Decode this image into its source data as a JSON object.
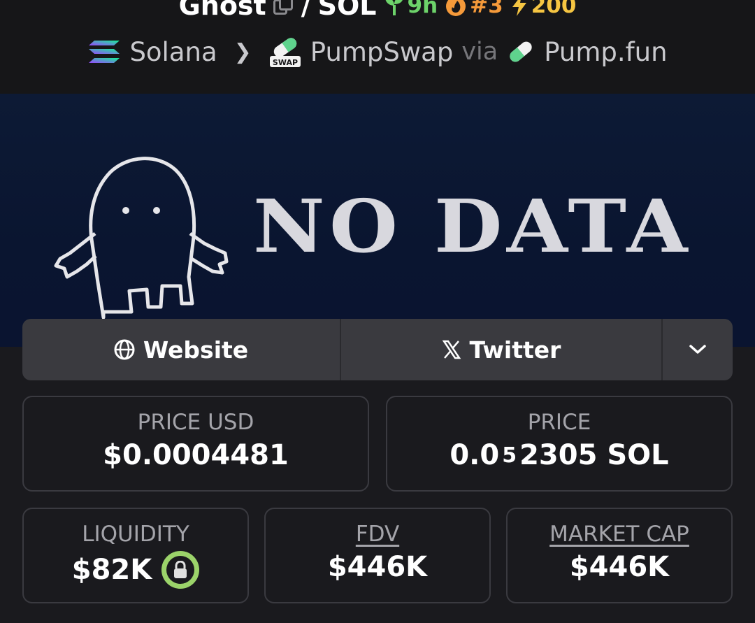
{
  "header": {
    "token_name": "Ghost",
    "pair_separator": "/",
    "quote": "SOL",
    "age": "9h",
    "rank": "#3",
    "boosts": "200"
  },
  "chain_row": {
    "chain": "Solana",
    "dex": "PumpSwap",
    "dex_badge": "SWAP",
    "via_label": "via",
    "launchpad": "Pump.fun"
  },
  "banner": {
    "text": "NO DATA"
  },
  "links": {
    "website_label": "Website",
    "twitter_label": "Twitter"
  },
  "stats": {
    "price_usd_label": "PRICE USD",
    "price_usd_value": "$0.0004481",
    "price_label": "PRICE",
    "price_prefix": "0.0",
    "price_zeros": "5",
    "price_digits": "2305",
    "price_unit": "SOL",
    "liquidity_label": "LIQUIDITY",
    "liquidity_value": "$82K",
    "fdv_label": "FDV",
    "fdv_value": "$446K",
    "mcap_label": "MARKET CAP",
    "mcap_value": "$446K"
  },
  "colors": {
    "age": "#6dd36a",
    "rank": "#f59a3a",
    "boost": "#f5c542",
    "lock": "#9bd36a"
  }
}
